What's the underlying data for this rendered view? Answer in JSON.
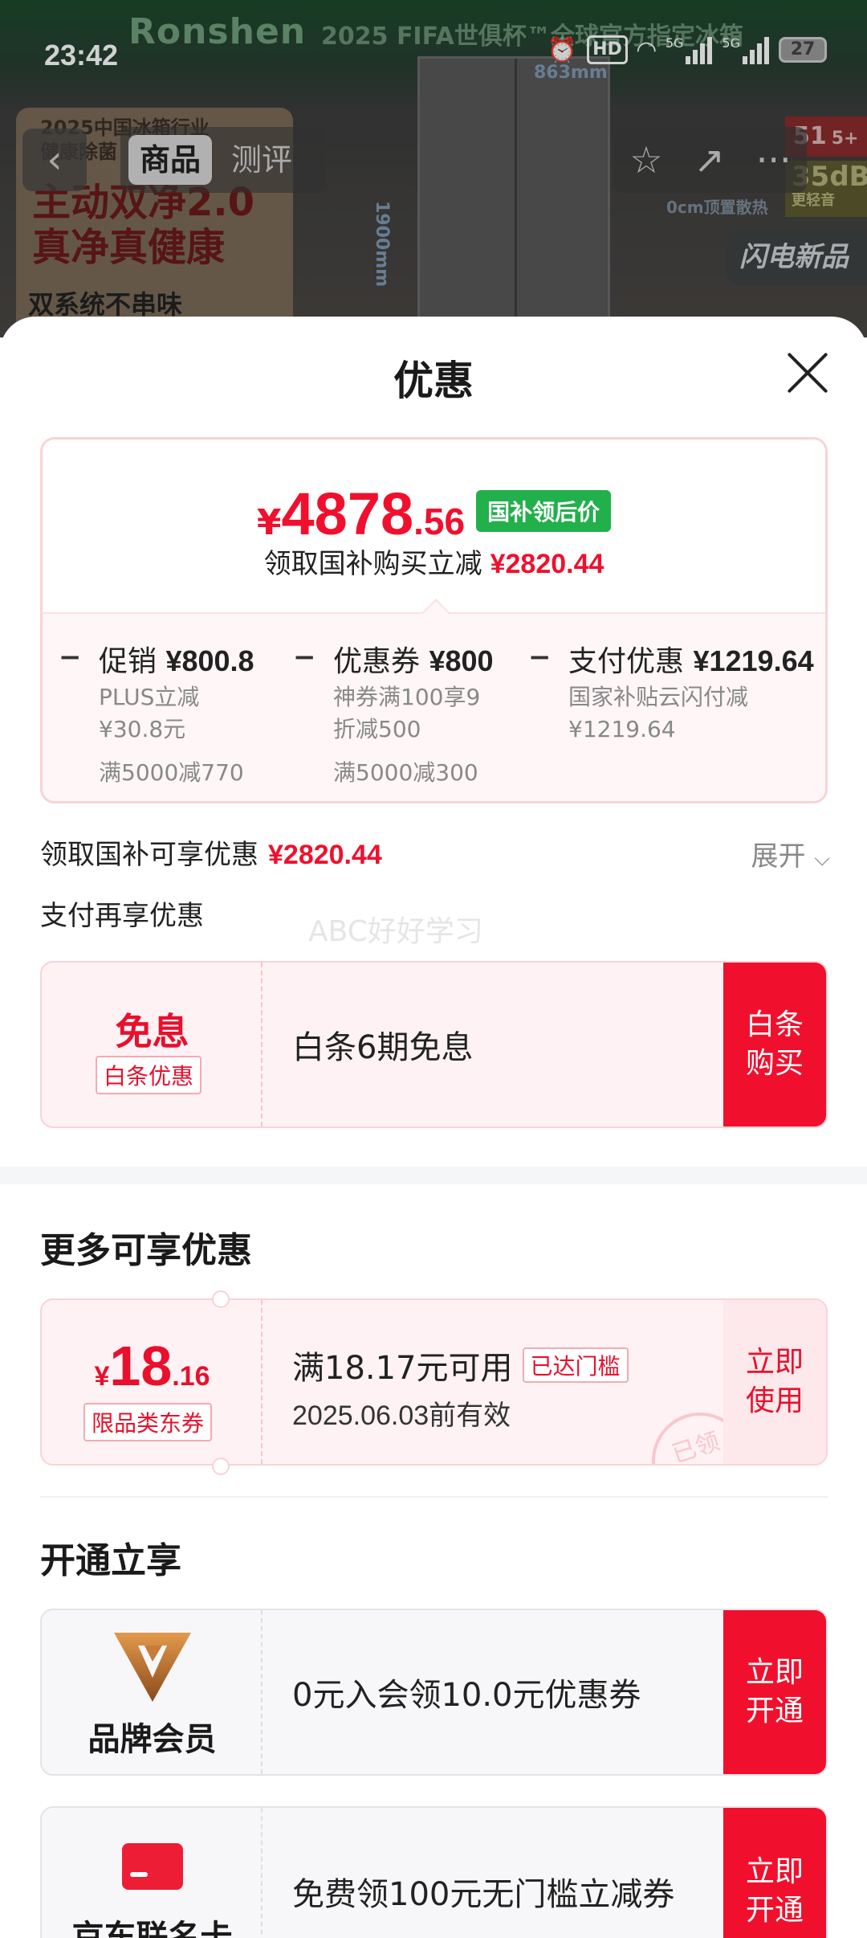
{
  "status": {
    "time": "23:42",
    "battery": "27",
    "hd": "HD",
    "net1": "5G",
    "net2": "5G"
  },
  "background": {
    "brand": "Ronshen",
    "brand_sub": "2025 FIFA世俱杯™全球官方指定冰箱",
    "promo_line1": "2025中国冰箱行业",
    "promo_line2": "健康除菌",
    "promo_slogan": "主动双净2.0 真净真健康",
    "promo_feature": "双系统不串味",
    "dim_width": "863mm",
    "dim_height": "1900mm",
    "tag_1": "51",
    "tag_1b": "5+",
    "tag_2": "35dB",
    "tag_2b": "更轻音",
    "tag_3": "闪电新品",
    "tag_4": "0cm顶置散热"
  },
  "nav": {
    "back_icon": "‹",
    "tabs": [
      {
        "label": "商品",
        "active": true
      },
      {
        "label": "测评",
        "active": false
      }
    ],
    "actions": [
      "☆",
      "↗",
      "···"
    ]
  },
  "sheet": {
    "title": "优惠",
    "price": {
      "yen": "¥",
      "integer": "4878",
      "decimal": ".56",
      "badge": "国补领后价",
      "sub_text": "领取国补购买立减",
      "sub_amount": "¥2820.44"
    },
    "breakdown": [
      {
        "minus": "−",
        "label": "促销",
        "amount": "¥800.8",
        "desc1": "PLUS立减",
        "desc2": "¥30.8元",
        "cond": "满5000减770"
      },
      {
        "minus": "−",
        "label": "优惠券",
        "amount": "¥800",
        "desc1": "神券满100享9",
        "desc2": "折减500",
        "cond": "满5000减300"
      },
      {
        "minus": "−",
        "label": "支付优惠",
        "amount": "¥1219.64",
        "desc1": "国家补贴云闪付减",
        "desc2": "¥1219.64",
        "cond": ""
      }
    ],
    "subsidy_text": "领取国补可享优惠",
    "subsidy_amount": "¥2820.44",
    "expand_label": "展开",
    "pay_more_text": "支付再享优惠",
    "watermark": "ABC好好学习",
    "baitiao": {
      "tag_big": "免息",
      "tag_small": "白条优惠",
      "text": "白条6期免息",
      "action": "白条购买"
    },
    "more_title": "更多可享优惠",
    "coupon": {
      "yen": "¥",
      "integer": "18",
      "decimal": ".16",
      "tag": "限品类东券",
      "condition": "满18.17元可用",
      "badge": "已达门槛",
      "date": "2025.06.03前有效",
      "stamp": "已领",
      "action": "立即使用"
    },
    "open_title": "开通立享",
    "brand_member": {
      "name": "品牌会员",
      "text": "0元入会领10.0元优惠券",
      "action": "立即开通"
    },
    "jd_card": {
      "name": "京东联名卡",
      "text": "免费领100元无门槛立减券",
      "action": "立即开通"
    }
  },
  "colors": {
    "accent": "#f0102d",
    "green_badge": "#22b04b"
  }
}
